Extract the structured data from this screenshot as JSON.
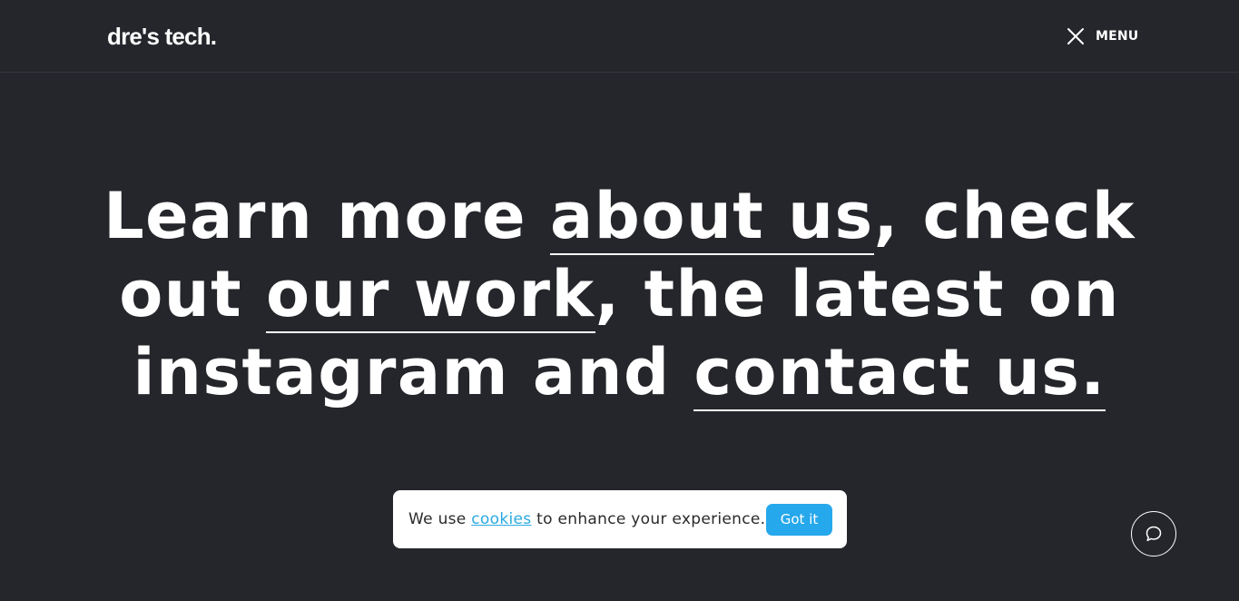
{
  "header": {
    "logo": "dre's tech.",
    "menu_label": "MENU",
    "menu_icon": "close-icon"
  },
  "hero": {
    "line1_a": "Learn more ",
    "line1_link": "about us",
    "line1_b": ", check",
    "line2_a": "out ",
    "line2_link": "our work",
    "line2_b": ", the latest on",
    "line3_a": "instagram and ",
    "line3_link": "contact us."
  },
  "cookie_banner": {
    "text_before": "We use ",
    "link": "cookies",
    "text_after": " to enhance your experience.",
    "button_label": "Got it"
  },
  "chat": {
    "icon": "chat-bubble-icon"
  },
  "colors": {
    "background": "#24262b",
    "text": "#ffffff",
    "accent": "#26a8ec",
    "link": "#2aa9e0"
  }
}
